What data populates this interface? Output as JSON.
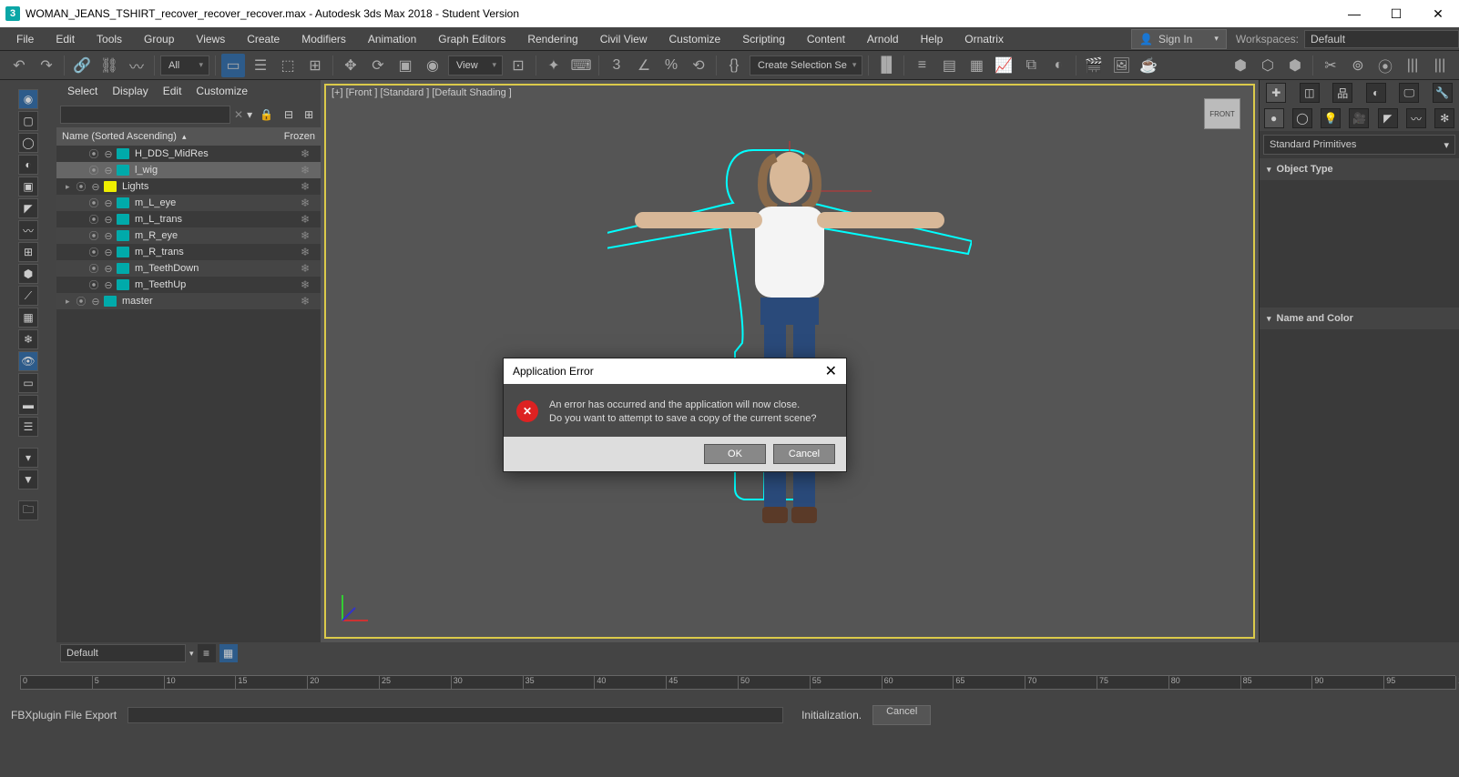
{
  "window": {
    "title": "WOMAN_JEANS_TSHIRT_recover_recover_recover.max - Autodesk 3ds Max 2018 - Student Version",
    "icon": "3"
  },
  "menu": {
    "items": [
      "File",
      "Edit",
      "Tools",
      "Group",
      "Views",
      "Create",
      "Modifiers",
      "Animation",
      "Graph Editors",
      "Rendering",
      "Civil View",
      "Customize",
      "Scripting",
      "Content",
      "Arnold",
      "Help",
      "Ornatrix"
    ]
  },
  "signin": "Sign In",
  "workspace": {
    "label": "Workspaces:",
    "value": "Default"
  },
  "toolbar": {
    "all": "All",
    "view": "View",
    "selset": "Create Selection Se"
  },
  "scene": {
    "tabs": [
      "Select",
      "Display",
      "Edit",
      "Customize"
    ],
    "head1": "Name (Sorted Ascending)",
    "head2": "Frozen",
    "items": [
      {
        "name": "H_DDS_MidRes",
        "indent": 1
      },
      {
        "name": "l_wig",
        "indent": 1,
        "sel": true
      },
      {
        "name": "Lights",
        "indent": 0,
        "type": "lt",
        "exp": true
      },
      {
        "name": "m_L_eye",
        "indent": 1
      },
      {
        "name": "m_L_trans",
        "indent": 1
      },
      {
        "name": "m_R_eye",
        "indent": 1
      },
      {
        "name": "m_R_trans",
        "indent": 1
      },
      {
        "name": "m_TeethDown",
        "indent": 1
      },
      {
        "name": "m_TeethUp",
        "indent": 1
      },
      {
        "name": "master",
        "indent": 0,
        "exp": true
      }
    ]
  },
  "viewport": {
    "label": "[+] [Front ] [Standard ] [Default Shading ]",
    "cube": "FRONT"
  },
  "right": {
    "dropdown": "Standard Primitives",
    "sec1": "Object Type",
    "sec2": "Name and Color"
  },
  "layer": {
    "name": "Default"
  },
  "timeline": {
    "start": 0,
    "end": 100,
    "step": 5
  },
  "status": {
    "msg": "FBXplugin File Export",
    "init": "Initialization.",
    "cancel": "Cancel"
  },
  "modal": {
    "title": "Application Error",
    "line1": "An error has occurred and the application will now close.",
    "line2": "Do you want to attempt to save a copy of the current scene?",
    "ok": "OK",
    "cancel": "Cancel"
  }
}
